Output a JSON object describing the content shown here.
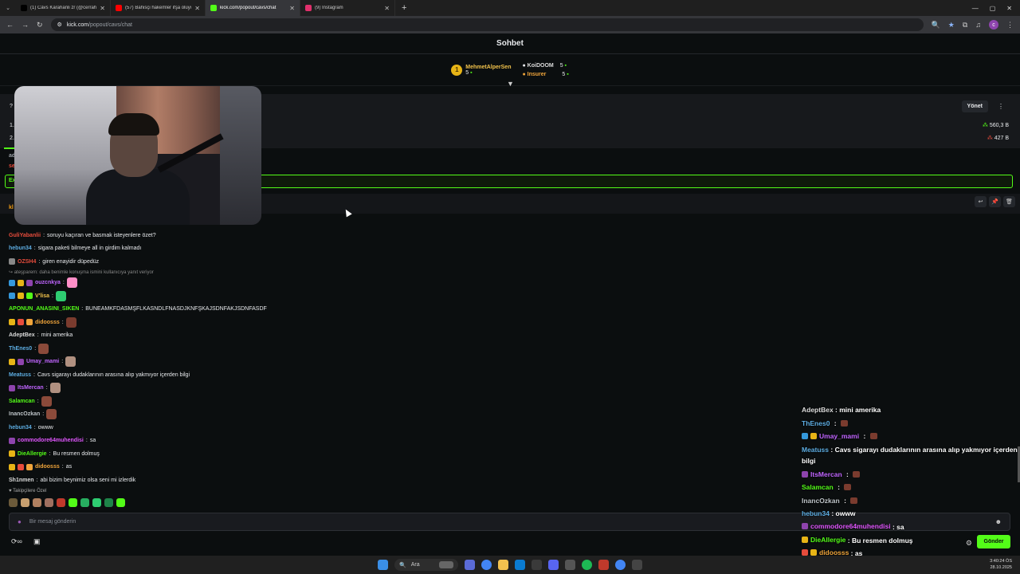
{
  "browser": {
    "tabs": [
      {
        "title": "(1) Cävs Karahanli zr (@cerrahp",
        "color": "#000000",
        "active": false
      },
      {
        "title": "(57) Bahisçi hakemler ifşa oluyo",
        "color": "#ff0000",
        "active": false
      },
      {
        "title": "kick.com/popout/cavs/chat",
        "color": "#53fc18",
        "active": true
      },
      {
        "title": "(9) Instagram",
        "color": "#e1306c",
        "active": false
      }
    ],
    "new_tab": "+",
    "url_host": "kick.com",
    "url_path": "/popout/cavs/chat",
    "profile_initial": "c"
  },
  "chat": {
    "header_title": "Sohbet",
    "leaderboard": {
      "first": {
        "rank": "1",
        "name": "MehmetAlperSen",
        "count": "5"
      },
      "second": {
        "name": "KoiDOOM",
        "count": "5"
      },
      "third": {
        "name": "Insurer",
        "count": "5"
      }
    },
    "pinned": {
      "question_prefix": "?",
      "manage_label": "Yönet",
      "more": "⋮",
      "option1_num": "1.",
      "option2_num": "2.",
      "option1_value": "560,3 B",
      "option2_value": "427 B"
    },
    "partial_rows": [
      {
        "text": "ad",
        "color": "#9aa0a6"
      },
      {
        "text": "se",
        "color": "#e74c3c"
      },
      {
        "text": "Ex",
        "color": "#53fc18"
      },
      {
        "text": "↩",
        "color": "#f39c12"
      },
      {
        "text": "kl",
        "color": "#f39c12"
      }
    ],
    "messages": [
      {
        "user": "GuliYabanlii",
        "color": "#e74c3c",
        "text": "soruyu kaçıran ve basmak isteyenlere özet?",
        "badges": []
      },
      {
        "user": "hebun34",
        "color": "#5dade2",
        "text": "sigara paketi bilmeye all in girdim kalmadı",
        "badges": []
      },
      {
        "user": "OZSH4",
        "color": "#e74c3c",
        "text": "giren enayidir düpedüz",
        "badges": [
          "#888888"
        ]
      },
      {
        "reply": "ateşparem: daha benimle konuşma ismini kullanıcıya yanıt veriyor"
      },
      {
        "user": "ouzcnkya",
        "color": "#c065ff",
        "text": "",
        "badges": [
          "#3498db",
          "#e7b416",
          "#8e44ad"
        ],
        "emote": "#ff8fc8"
      },
      {
        "user": "V'lisa",
        "color": "#f0c14b",
        "text": "",
        "badges": [
          "#3498db",
          "#e7b416",
          "#53fc18"
        ],
        "emote": "#2ecc71"
      },
      {
        "user": "APONUN_ANASINI_SIKEN",
        "color": "#53fc18",
        "text": "BUNEAMKFDASMŞFLKASNDLFNASDJKNFŞKAJSDNFAKJSDNFASDF",
        "badges": []
      },
      {
        "user": "didoosss",
        "color": "#f0a53b",
        "text": "",
        "badges": [
          "#e7b416",
          "#e74c3c",
          "#f0a53b"
        ],
        "emote": "#7a3b2e"
      },
      {
        "user": "AdeptBex",
        "color": "#dcdcdc",
        "text": "mini amerika",
        "badges": []
      },
      {
        "user": "ThEnes0",
        "color": "#5dade2",
        "text": "",
        "badges": [],
        "emote": "#8b4a3a"
      },
      {
        "user": "Umay_mami",
        "color": "#c065ff",
        "text": "",
        "badges": [
          "#e7b416",
          "#8e44ad"
        ],
        "emote": "#b09080"
      },
      {
        "user": "Meatuss",
        "color": "#5dade2",
        "text": "Cavs sigarayı dudaklarının arasına alıp yakmıyor içerden bilgi",
        "badges": []
      },
      {
        "user": "ItsMercan",
        "color": "#c065ff",
        "text": "",
        "badges": [
          "#8e44ad"
        ],
        "emote": "#b09080"
      },
      {
        "user": "Salamcan",
        "color": "#53fc18",
        "text": "",
        "badges": [],
        "emote": "#8b4a3a"
      },
      {
        "user": "InancOzkan",
        "color": "#bdc3c7",
        "text": "",
        "badges": [],
        "emote": "#8b4a3a"
      },
      {
        "user": "hebun34",
        "color": "#5dade2",
        "text": "owww",
        "badges": []
      },
      {
        "user": "commodore64muhendisi",
        "color": "#e056fd",
        "text": "sa",
        "badges": [
          "#8e44ad"
        ]
      },
      {
        "user": "DieAllergie",
        "color": "#53fc18",
        "text": "Bu resmen dolmuş",
        "badges": [
          "#e7b416"
        ]
      },
      {
        "user": "didoosss",
        "color": "#f0a53b",
        "text": "as",
        "badges": [
          "#e7b416",
          "#e74c3c",
          "#f0a53b"
        ]
      },
      {
        "user": "Sh1nmen",
        "color": "#dcdcdc",
        "text": "abi bizim beynimiz olsa seni mi izlerdik",
        "badges": []
      }
    ],
    "followers_label": "Takipçilere Özel",
    "input_placeholder": "Bir mesaj gönderin",
    "send_label": "Gönder"
  },
  "overlay": {
    "messages": [
      {
        "user": "AdeptBex",
        "color": "#dcdcdc",
        "text": "mini amerika"
      },
      {
        "user": "ThEnes0",
        "color": "#5dade2",
        "text": "",
        "emote": true
      },
      {
        "user": "Umay_mami",
        "color": "#c065ff",
        "text": "",
        "emote": true,
        "badges": [
          "#3498db",
          "#e7b416"
        ]
      },
      {
        "user": "Meatuss",
        "color": "#5dade2",
        "text": "Cavs sigarayı dudaklarının arasına alıp yakmıyor içerden bilgi",
        "tall": true
      },
      {
        "user": "ItsMercan",
        "color": "#c065ff",
        "text": "",
        "emote": true,
        "badges": [
          "#8e44ad"
        ]
      },
      {
        "user": "Salamcan",
        "color": "#53fc18",
        "text": "",
        "emote": true
      },
      {
        "user": "InancOzkan",
        "color": "#bdc3c7",
        "text": "",
        "emote": true
      },
      {
        "user": "hebun34",
        "color": "#5dade2",
        "text": "owww"
      },
      {
        "user": "commodore64muhendisi",
        "color": "#e056fd",
        "text": "sa",
        "badges": [
          "#8e44ad"
        ]
      },
      {
        "user": "DieAllergie",
        "color": "#53fc18",
        "text": "Bu resmen dolmuş",
        "badges": [
          "#e7b416"
        ]
      },
      {
        "user": "didoosss",
        "color": "#f0a53b",
        "text": "as",
        "badges": [
          "#e74c3c",
          "#e7b416"
        ]
      },
      {
        "user": "Sh1nmen",
        "color": "#5dade2",
        "text": "abi bizim beynimiz olsa seni mi izlerdik"
      }
    ]
  },
  "taskbar": {
    "search_label": "Ara",
    "time": "3:40:24 ÖS",
    "date": "28.10.2025"
  },
  "colors": {
    "accent": "#53fc18",
    "background": "#0b0e0f",
    "gold": "#e7b416"
  }
}
